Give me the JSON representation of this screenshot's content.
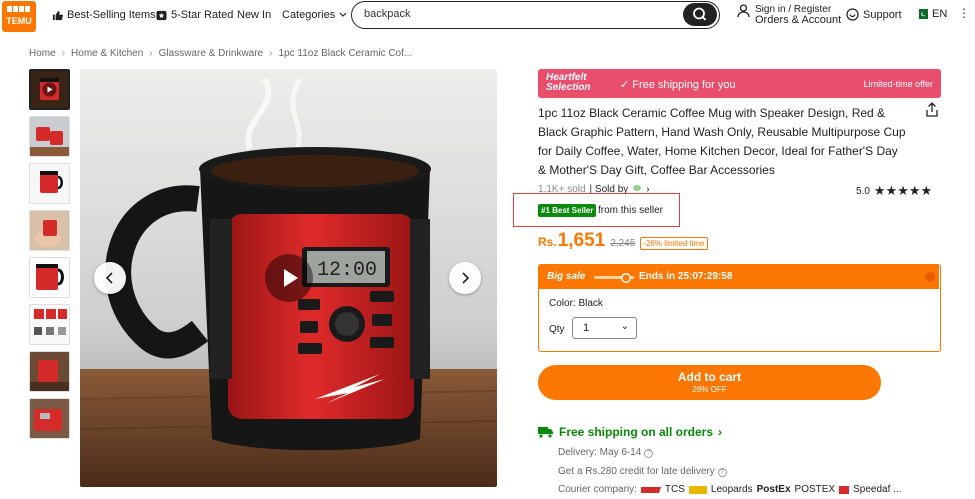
{
  "header": {
    "logo_top": "⬛⬛⬛⬛",
    "logo_text": "TEMU",
    "nav": [
      "Best-Selling Items",
      "5-Star Rated",
      "New In",
      "Categories"
    ],
    "search_value": "backpack",
    "account_line1": "Sign in / Register",
    "account_line2": "Orders & Account",
    "support": "Support",
    "lang": "EN",
    "more": "⋮"
  },
  "breadcrumb": [
    "Home",
    "Home & Kitchen",
    "Glassware & Drinkware",
    "1pc 11oz Black Ceramic Cof..."
  ],
  "product": {
    "banner_line1": "Heartfelt",
    "banner_line2": "Selection",
    "banner_free": "✓ Free shipping for you",
    "banner_limited": "Limited-time offer",
    "title": "1pc 11oz Black Ceramic Coffee Mug with Speaker Design, Red & Black Graphic Pattern, Hand Wash Only, Reusable Multipurpose Cup for Daily Coffee, Water, Home Kitchen Decor, Ideal for Father'S Day & Mother'S Day Gift, Coffee Bar Accessories",
    "sold": "1.1K+ sold",
    "sold_by": "| Sold by",
    "rating_value": "5.0",
    "stars": "★★★★★",
    "best_badge": "#1 Best Seller",
    "best_from": "from this seller",
    "currency": "Rs.",
    "price": "1,651",
    "old_price": "2,245",
    "discount": "-26% limited time",
    "big_sale": "Big sale",
    "sale_sep": "|",
    "ends_in": "Ends in 25:07:29:58",
    "color": "Color: Black",
    "qty_label": "Qty",
    "qty_value": "1",
    "cart_label": "Add to cart",
    "cart_sub": "26% OFF",
    "ship": "Free shipping on all orders",
    "ship_chev": "›",
    "delivery": "Delivery: May 6-14",
    "credit": "Get a Rs.280 credit for late delivery",
    "courier_label": "Courier company:",
    "couriers": [
      "TCS",
      "Leopards",
      "PostEx",
      "POSTEX",
      "Speedaf ..."
    ]
  },
  "colors": {
    "brand": "#fb7701",
    "banner": "#ea4e6d",
    "green": "#0a8a0a",
    "highlight": "#e04040"
  }
}
